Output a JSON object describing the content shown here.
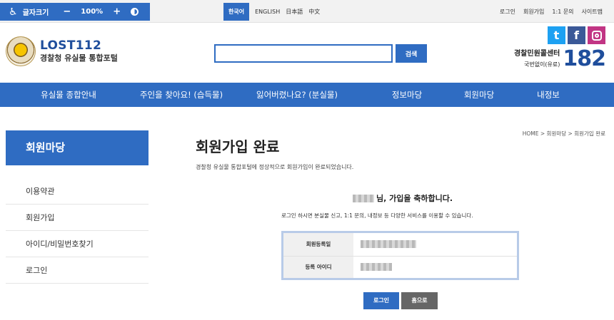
{
  "topbar": {
    "font_size_label": "글자크기",
    "minus": "−",
    "zoom": "100%",
    "plus": "+",
    "languages": [
      "한국어",
      "ENGLISH",
      "日本語",
      "中文"
    ],
    "utility_links": [
      "로그인",
      "회원가입",
      "1:1 문의",
      "사이트맵"
    ]
  },
  "header": {
    "logo_title": "LOST112",
    "logo_subtitle": "경찰청 유실물 통합포털",
    "search_placeholder": "",
    "search_button": "검색",
    "social": [
      "t",
      "f"
    ],
    "call_center_name": "경찰민원콜센터",
    "call_center_desc": "국번없이(유료)",
    "call_center_number": "182"
  },
  "nav": {
    "items": [
      "유실물 종합안내",
      "주인을 찾아요! (습득물)",
      "잃어버렸나요? (분실물)",
      "정보마당",
      "회원마당",
      "내정보"
    ]
  },
  "sidebar": {
    "title": "회원마당",
    "items": [
      "이용약관",
      "회원가입",
      "아이디/비밀번호찾기",
      "로그인"
    ]
  },
  "main": {
    "breadcrumb": "HOME > 회원마당 > 회원가입 완료",
    "title": "회원가입 완료",
    "description": "경찰청 유실물 통합포털에 정상적으로 회원가입이 완료되었습니다.",
    "welcome_suffix": "님, 가입을 축하합니다.",
    "info_message": "로그인 하시면 분실물 신고, 1:1 문의, 내정보 등 다양한 서비스를 이용할 수 있습니다.",
    "info_rows": [
      {
        "label": "회원등록일"
      },
      {
        "label": "등록 아이디"
      }
    ],
    "login_button": "로그인",
    "home_button": "홈으로"
  },
  "colors": {
    "primary": "#2f6cc2",
    "home_button": "#666666",
    "info_border": "#b8cbe8"
  }
}
